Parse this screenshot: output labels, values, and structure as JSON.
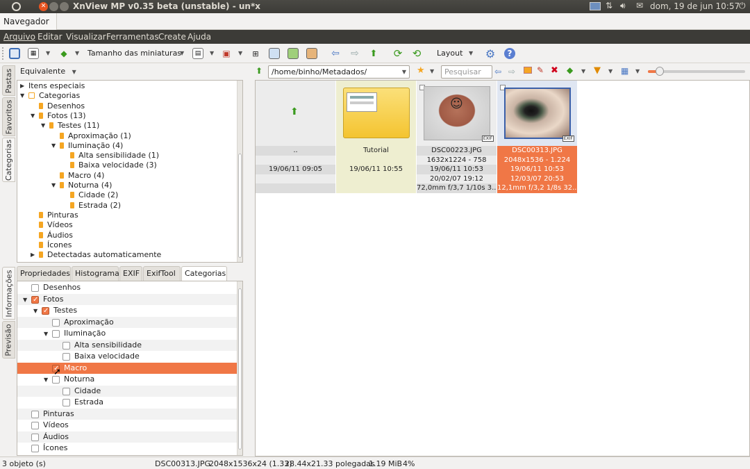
{
  "system_panel": {
    "title": "XnView MP v0.35 beta (unstable) - un*x",
    "datetime": "dom, 19 de jun 10:57"
  },
  "window_tab": {
    "label": "Navegador",
    "close": "✖"
  },
  "menu": [
    "Arquivo",
    "Editar",
    "Visualizar",
    "Ferramentas",
    "Create",
    "Ajuda"
  ],
  "toolbar": {
    "thumb_size_label": "Tamanho das miniaturas",
    "layout_label": "Layout"
  },
  "side_tabs_top": [
    "Pastas",
    "Favoritos",
    "Categorias"
  ],
  "side_tabs_bottom": [
    "Informações",
    "Previsão"
  ],
  "tree_filter": "Equivalente",
  "tree": [
    {
      "label": "Itens especiais",
      "level": 0,
      "exp": "▶",
      "icon": false
    },
    {
      "label": "Categorias",
      "level": 0,
      "exp": "▼",
      "icon": true
    },
    {
      "label": "Desenhos",
      "level": 1,
      "exp": "",
      "icon": true
    },
    {
      "label": "Fotos (13)",
      "level": 1,
      "exp": "▼",
      "icon": true
    },
    {
      "label": "Testes (11)",
      "level": 2,
      "exp": "▼",
      "icon": true
    },
    {
      "label": "Aproximação (1)",
      "level": 3,
      "exp": "",
      "icon": true
    },
    {
      "label": "Iluminação (4)",
      "level": 3,
      "exp": "▼",
      "icon": true
    },
    {
      "label": "Alta sensibilidade (1)",
      "level": 4,
      "exp": "",
      "icon": true
    },
    {
      "label": "Baixa velocidade (3)",
      "level": 4,
      "exp": "",
      "icon": true
    },
    {
      "label": "Macro (4)",
      "level": 3,
      "exp": "",
      "icon": true
    },
    {
      "label": "Noturna (4)",
      "level": 3,
      "exp": "▼",
      "icon": true
    },
    {
      "label": "Cidade (2)",
      "level": 4,
      "exp": "",
      "icon": true
    },
    {
      "label": "Estrada (2)",
      "level": 4,
      "exp": "",
      "icon": true
    },
    {
      "label": "Pinturas",
      "level": 1,
      "exp": "",
      "icon": true
    },
    {
      "label": "Vídeos",
      "level": 1,
      "exp": "",
      "icon": true
    },
    {
      "label": "Áudios",
      "level": 1,
      "exp": "",
      "icon": true
    },
    {
      "label": "Ícones",
      "level": 1,
      "exp": "",
      "icon": true
    },
    {
      "label": "Detectadas automaticamente",
      "level": 1,
      "exp": "▶",
      "icon": true
    }
  ],
  "info_tabs": [
    "Propriedades",
    "Histograma",
    "EXIF",
    "ExifTool",
    "Categorias"
  ],
  "categories": [
    {
      "label": "Desenhos",
      "level": 0,
      "exp": "",
      "checked": false,
      "selected": false
    },
    {
      "label": "Fotos",
      "level": 0,
      "exp": "▼",
      "checked": true,
      "selected": false
    },
    {
      "label": "Testes",
      "level": 1,
      "exp": "▼",
      "checked": true,
      "selected": false
    },
    {
      "label": "Aproximação",
      "level": 2,
      "exp": "",
      "checked": false,
      "selected": false
    },
    {
      "label": "Iluminação",
      "level": 2,
      "exp": "▼",
      "checked": false,
      "selected": false
    },
    {
      "label": "Alta sensibilidade",
      "level": 3,
      "exp": "",
      "checked": false,
      "selected": false
    },
    {
      "label": "Baixa velocidade",
      "level": 3,
      "exp": "",
      "checked": false,
      "selected": false
    },
    {
      "label": "Macro",
      "level": 2,
      "exp": "",
      "checked": true,
      "selected": true
    },
    {
      "label": "Noturna",
      "level": 2,
      "exp": "▼",
      "checked": false,
      "selected": false
    },
    {
      "label": "Cidade",
      "level": 3,
      "exp": "",
      "checked": false,
      "selected": false
    },
    {
      "label": "Estrada",
      "level": 3,
      "exp": "",
      "checked": false,
      "selected": false
    },
    {
      "label": "Pinturas",
      "level": 0,
      "exp": "",
      "checked": false,
      "selected": false
    },
    {
      "label": "Vídeos",
      "level": 0,
      "exp": "",
      "checked": false,
      "selected": false
    },
    {
      "label": "Áudios",
      "level": 0,
      "exp": "",
      "checked": false,
      "selected": false
    },
    {
      "label": "Ícones",
      "level": 0,
      "exp": "",
      "checked": false,
      "selected": false
    }
  ],
  "address": {
    "path": "/home/binho/Metadados/",
    "search_placeholder": "Pesquisar"
  },
  "thumbnails": [
    {
      "kind": "parent",
      "lines": [
        "..",
        "",
        "19/06/11 09:05",
        "",
        ""
      ],
      "selected": false
    },
    {
      "kind": "folder",
      "lines": [
        "Tutorial",
        "",
        "19/06/11 10:55",
        "",
        ""
      ],
      "selected": false
    },
    {
      "kind": "photo-finger",
      "lines": [
        "DSC00223.JPG",
        "1632x1224 - 758",
        "19/06/11 10:53",
        "20/02/07 19:12",
        "72,0mm f/3,7 1/10s 3..."
      ],
      "selected": false
    },
    {
      "kind": "photo-eye",
      "lines": [
        "DSC00313.JPG",
        "2048x1536 - 1.224",
        "19/06/11 10:53",
        "12/03/07 20:53",
        "12,1mm f/3,2 1/8s 32..."
      ],
      "selected": true
    }
  ],
  "status": {
    "count": "3 objeto (s)",
    "file": "DSC00313.JPG",
    "dims": "2048x1536x24 (1.33)",
    "inches": "28.44x21.33 polegadas",
    "size": "1.19 MiB",
    "zoom": "4%"
  },
  "colors": {
    "accent": "#f07746",
    "folder": "#f9d04a",
    "bookmark": "#f5a623"
  }
}
